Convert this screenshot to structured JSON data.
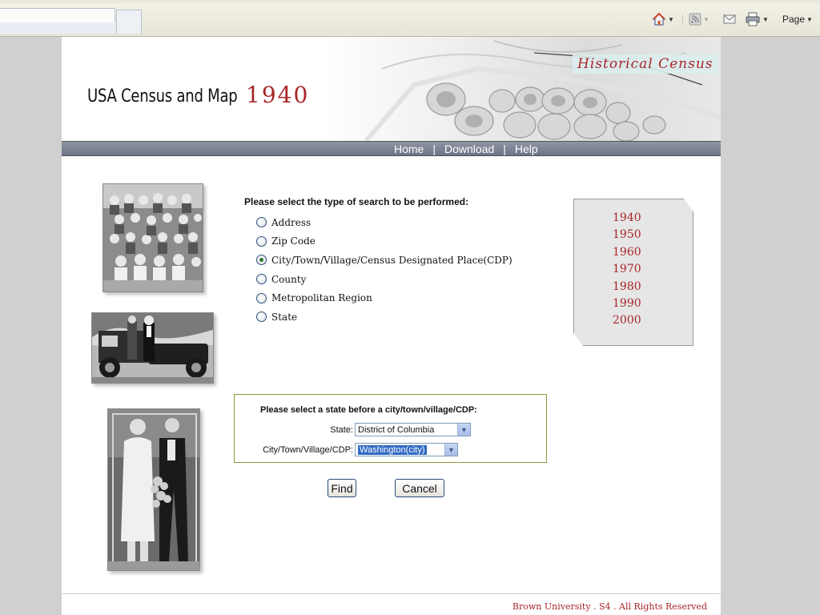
{
  "browser": {
    "toolbar": {
      "page_menu_label": "Page"
    }
  },
  "site": {
    "title": "USA Census and Map",
    "year": "1940",
    "badge": "Historical Census"
  },
  "nav": {
    "items": [
      "Home",
      "Download",
      "Help"
    ]
  },
  "search": {
    "title": "Please select the type of search to be performed:",
    "options": [
      {
        "label": "Address",
        "checked": false
      },
      {
        "label": "Zip Code",
        "checked": false
      },
      {
        "label": "City/Town/Village/Census Designated Place(CDP)",
        "checked": true
      },
      {
        "label": "County",
        "checked": false
      },
      {
        "label": "Metropolitan Region",
        "checked": false
      },
      {
        "label": "State",
        "checked": false
      }
    ]
  },
  "years": [
    "1940",
    "1950",
    "1960",
    "1970",
    "1980",
    "1990",
    "2000"
  ],
  "selection": {
    "prompt": "Please select a state before a city/town/village/CDP:",
    "state_label": "State:",
    "state_value": "District of Columbia",
    "city_label": "City/Town/Village/CDP:",
    "city_value": "Washington(city)"
  },
  "buttons": {
    "find": "Find",
    "cancel": "Cancel"
  },
  "footer": {
    "text": "Brown University . S4 . All Rights Reserved"
  },
  "colors": {
    "accent_red": "#a8262a",
    "nav_bar": "#7a8092",
    "box_border": "#8a9a3a"
  }
}
